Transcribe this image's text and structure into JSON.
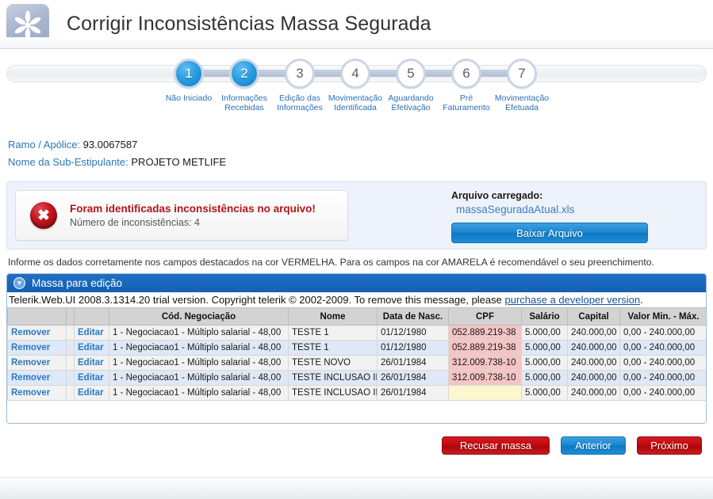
{
  "header": {
    "title": "Corrigir Inconsistências Massa Segurada",
    "logo_icon": "asterisk-flower-icon"
  },
  "stepper": {
    "steps": [
      {
        "number": "1",
        "label": "Não Iniciado",
        "active": true
      },
      {
        "number": "2",
        "label": "Informações\nRecebidas",
        "active": true
      },
      {
        "number": "3",
        "label": "Edição das\nInformações",
        "active": false
      },
      {
        "number": "4",
        "label": "Movimentação\nIdentificada",
        "active": false
      },
      {
        "number": "5",
        "label": "Aguardando\nEfetivação",
        "active": false
      },
      {
        "number": "6",
        "label": "Pré\nFaturamento",
        "active": false
      },
      {
        "number": "7",
        "label": "Movimentação\nEfetuada",
        "active": false
      }
    ]
  },
  "info": {
    "ramo_label": "Ramo / Apólice:",
    "ramo_value": "93.0067587",
    "sub_label": "Nome da Sub-Estipulante:",
    "sub_value": "PROJETO METLIFE"
  },
  "alert": {
    "icon": "error-x-icon",
    "icon_glyph": "✖",
    "title": "Foram identificadas inconsistências no arquivo!",
    "subtitle": "Número de inconsistências: 4"
  },
  "file": {
    "label": "Arquivo carregado:",
    "name": "massaSeguradaAtual.xls",
    "download_button": "Baixar Arquivo"
  },
  "instruction": "Informe os dados corretamente nos campos destacados na cor VERMELHA. Para os campos na cor AMARELA é recomendável o seu preenchimento.",
  "grid": {
    "panel_title": "Massa para edição",
    "collapse_icon": "chevron-down-icon",
    "collapse_glyph": "▼",
    "trial_prefix": "Telerik.Web.UI 2008.3.1314.20 trial version. Copyright telerik © 2002-2009. To remove this message, please ",
    "trial_link": "purchase a developer version",
    "trial_suffix": ".",
    "columns": [
      "",
      "",
      "",
      "Cód. Negociação",
      "Nome",
      "Data de Nasc.",
      "CPF",
      "Salário",
      "Capital",
      "Valor Min. - Máx."
    ],
    "action_remove": "Remover",
    "action_edit": "Editar",
    "rows": [
      {
        "remove": "Remover",
        "edit": "Editar",
        "codigo": "1 - Negociacao1 - Múltiplo salarial - 48,00",
        "nome": "TESTE 1",
        "nascimento": "01/12/1980",
        "cpf": "052.889.219-38",
        "cpf_state": "red",
        "salario": "5.000,00",
        "capital": "240.000,00",
        "valor": "0,00 - 240.000,00",
        "alt": false
      },
      {
        "remove": "Remover",
        "edit": "Editar",
        "codigo": "1 - Negociacao1 - Múltiplo salarial - 48,00",
        "nome": "TESTE 1",
        "nascimento": "01/12/1980",
        "cpf": "052.889.219-38",
        "cpf_state": "red",
        "salario": "5.000,00",
        "capital": "240.000,00",
        "valor": "0,00 - 240.000,00",
        "alt": true
      },
      {
        "remove": "Remover",
        "edit": "Editar",
        "codigo": "1 - Negociacao1 - Múltiplo salarial - 48,00",
        "nome": "TESTE NOVO",
        "nascimento": "26/01/1984",
        "cpf": "312.009.738-10",
        "cpf_state": "red",
        "salario": "5.000,00",
        "capital": "240.000,00",
        "valor": "0,00 - 240.000,00",
        "alt": false
      },
      {
        "remove": "Remover",
        "edit": "Editar",
        "codigo": "1 - Negociacao1 - Múltiplo salarial - 48,00",
        "nome": "TESTE INCLUSAO II",
        "nascimento": "26/01/1984",
        "cpf": "312.009.738-10",
        "cpf_state": "red",
        "salario": "5.000,00",
        "capital": "240.000,00",
        "valor": "0,00 - 240.000,00",
        "alt": true
      },
      {
        "remove": "Remover",
        "edit": "Editar",
        "codigo": "1 - Negociacao1 - Múltiplo salarial - 48,00",
        "nome": "TESTE INCLUSAO III",
        "nascimento": "26/01/1984",
        "cpf": "",
        "cpf_state": "yellow",
        "salario": "5.000,00",
        "capital": "240.000,00",
        "valor": "0,00 - 240.000,00",
        "alt": false
      }
    ]
  },
  "footer": {
    "recusar": "Recusar massa",
    "anterior": "Anterior",
    "proximo": "Próximo"
  },
  "colors": {
    "accent_blue": "#1560b2",
    "link_blue": "#2a7ac4",
    "error_red": "#b3141b",
    "cell_red": "#f5c4c4",
    "cell_yellow": "#fbf7cf"
  }
}
